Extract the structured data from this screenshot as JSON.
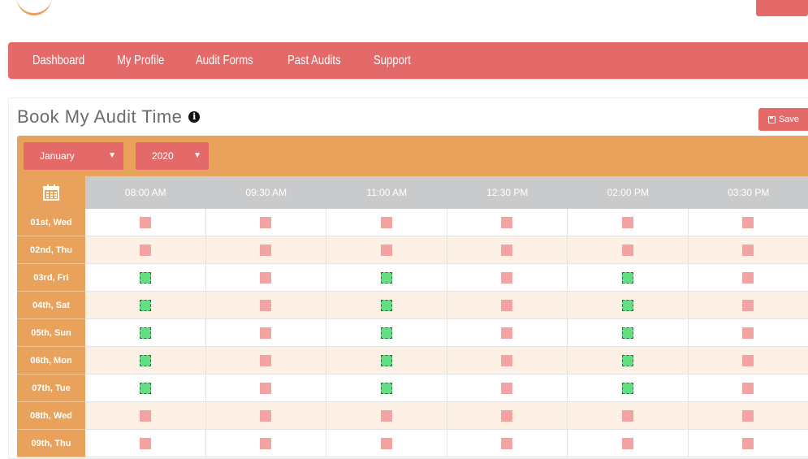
{
  "header": {},
  "nav": {
    "items": [
      "Dashboard",
      "My Profile",
      "Audit Forms",
      "Past Audits",
      "Support"
    ]
  },
  "panel": {
    "title": "Book My Audit Time",
    "info_icon": "info-icon",
    "save_label": "Save",
    "save_icon": "floppy-disk-icon"
  },
  "filters": {
    "month": "January",
    "year": "2020"
  },
  "calendar": {
    "header_icon": "calendar-icon",
    "times": [
      "08:00 AM",
      "09:30 AM",
      "11:00 AM",
      "12:30 PM",
      "02:00 PM",
      "03:30 PM"
    ],
    "days": [
      {
        "label": "01st, Wed",
        "slots": [
          "unavailable",
          "unavailable",
          "unavailable",
          "unavailable",
          "unavailable",
          "unavailable"
        ]
      },
      {
        "label": "02nd, Thu",
        "slots": [
          "unavailable",
          "unavailable",
          "unavailable",
          "unavailable",
          "unavailable",
          "unavailable"
        ]
      },
      {
        "label": "03rd, Fri",
        "slots": [
          "available",
          "unavailable",
          "available",
          "unavailable",
          "available",
          "unavailable"
        ]
      },
      {
        "label": "04th, Sat",
        "slots": [
          "available",
          "unavailable",
          "available",
          "unavailable",
          "available",
          "unavailable"
        ]
      },
      {
        "label": "05th, Sun",
        "slots": [
          "available",
          "unavailable",
          "available",
          "unavailable",
          "available",
          "unavailable"
        ]
      },
      {
        "label": "06th, Mon",
        "slots": [
          "available",
          "unavailable",
          "available",
          "unavailable",
          "available",
          "unavailable"
        ]
      },
      {
        "label": "07th, Tue",
        "slots": [
          "available",
          "unavailable",
          "available",
          "unavailable",
          "available",
          "unavailable"
        ]
      },
      {
        "label": "08th, Wed",
        "slots": [
          "unavailable",
          "unavailable",
          "unavailable",
          "unavailable",
          "unavailable",
          "unavailable"
        ]
      },
      {
        "label": "09th, Thu",
        "slots": [
          "unavailable",
          "unavailable",
          "unavailable",
          "unavailable",
          "unavailable",
          "unavailable"
        ]
      }
    ]
  },
  "colors": {
    "primary": "#e46a6a",
    "accent": "#e8a25b",
    "header_gray": "#c9cacb",
    "slot_unavailable": "#f4a3a3",
    "slot_available": "#61df82",
    "row_alt": "#fdf1e6"
  }
}
